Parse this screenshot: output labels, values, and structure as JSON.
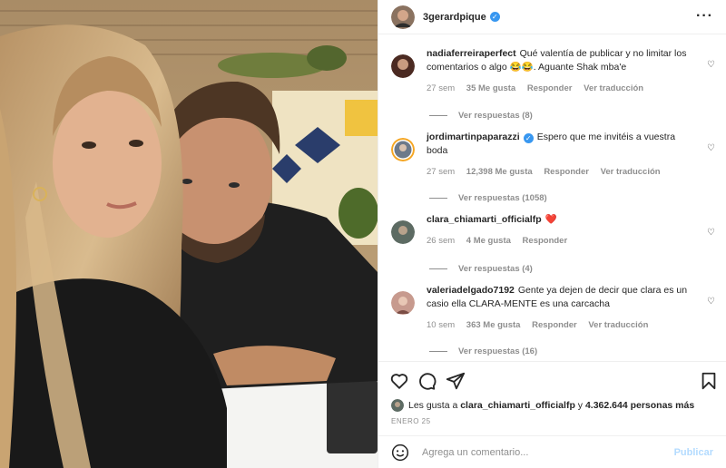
{
  "post": {
    "username": "3gerardpique",
    "verified": true
  },
  "comments": [
    {
      "username": "nadiaferreiraperfect",
      "text": "Qué valentía de publicar y no limitar los comentarios o algo 😂😂. Aguante Shak mba'e",
      "time": "27 sem",
      "likes": "35 Me gusta",
      "reply": "Responder",
      "translate": "Ver traducción",
      "replies": "Ver respuestas (8)"
    },
    {
      "username": "jordimartinpaparazzi",
      "verified": true,
      "text": "Espero que me invitéis a vuestra boda",
      "time": "27 sem",
      "likes": "12,398 Me gusta",
      "reply": "Responder",
      "translate": "Ver traducción",
      "replies": "Ver respuestas (1058)"
    },
    {
      "username": "clara_chiamarti_officialfp",
      "text": "❤️",
      "time": "26 sem",
      "likes": "4 Me gusta",
      "reply": "Responder",
      "replies": "Ver respuestas (4)"
    },
    {
      "username": "valeriadelgado7192",
      "text": "Gente ya dejen de decir que clara es un casio ella CLARA-MENTE es una carcacha",
      "time": "10 sem",
      "likes": "363 Me gusta",
      "reply": "Responder",
      "translate": "Ver traducción",
      "replies": "Ver respuestas (16)"
    }
  ],
  "likes": {
    "prefix": "Les gusta a",
    "user": "clara_chiamarti_officialfp",
    "middle": "y",
    "count": "4.362.644 personas más"
  },
  "date": "ENERO 25",
  "composer": {
    "placeholder": "Agrega un comentario...",
    "publish": "Publicar"
  },
  "icons": [
    "heart-icon",
    "comment-icon",
    "share-icon",
    "bookmark-icon",
    "emoji-icon",
    "more-icon"
  ]
}
